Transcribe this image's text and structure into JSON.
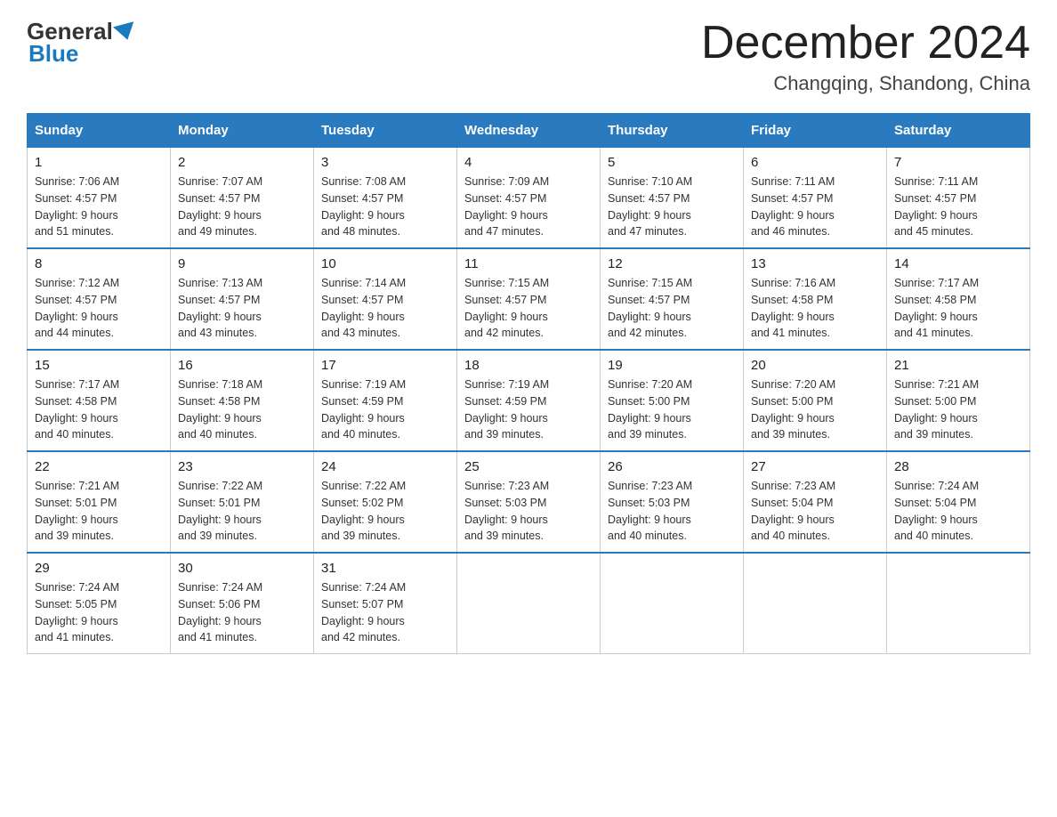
{
  "logo": {
    "general": "General",
    "blue": "Blue",
    "subtitle": "Blue"
  },
  "header": {
    "title": "December 2024",
    "subtitle": "Changqing, Shandong, China"
  },
  "days_of_week": [
    "Sunday",
    "Monday",
    "Tuesday",
    "Wednesday",
    "Thursday",
    "Friday",
    "Saturday"
  ],
  "weeks": [
    [
      {
        "day": "1",
        "sunrise": "7:06 AM",
        "sunset": "4:57 PM",
        "daylight": "9 hours and 51 minutes."
      },
      {
        "day": "2",
        "sunrise": "7:07 AM",
        "sunset": "4:57 PM",
        "daylight": "9 hours and 49 minutes."
      },
      {
        "day": "3",
        "sunrise": "7:08 AM",
        "sunset": "4:57 PM",
        "daylight": "9 hours and 48 minutes."
      },
      {
        "day": "4",
        "sunrise": "7:09 AM",
        "sunset": "4:57 PM",
        "daylight": "9 hours and 47 minutes."
      },
      {
        "day": "5",
        "sunrise": "7:10 AM",
        "sunset": "4:57 PM",
        "daylight": "9 hours and 47 minutes."
      },
      {
        "day": "6",
        "sunrise": "7:11 AM",
        "sunset": "4:57 PM",
        "daylight": "9 hours and 46 minutes."
      },
      {
        "day": "7",
        "sunrise": "7:11 AM",
        "sunset": "4:57 PM",
        "daylight": "9 hours and 45 minutes."
      }
    ],
    [
      {
        "day": "8",
        "sunrise": "7:12 AM",
        "sunset": "4:57 PM",
        "daylight": "9 hours and 44 minutes."
      },
      {
        "day": "9",
        "sunrise": "7:13 AM",
        "sunset": "4:57 PM",
        "daylight": "9 hours and 43 minutes."
      },
      {
        "day": "10",
        "sunrise": "7:14 AM",
        "sunset": "4:57 PM",
        "daylight": "9 hours and 43 minutes."
      },
      {
        "day": "11",
        "sunrise": "7:15 AM",
        "sunset": "4:57 PM",
        "daylight": "9 hours and 42 minutes."
      },
      {
        "day": "12",
        "sunrise": "7:15 AM",
        "sunset": "4:57 PM",
        "daylight": "9 hours and 42 minutes."
      },
      {
        "day": "13",
        "sunrise": "7:16 AM",
        "sunset": "4:58 PM",
        "daylight": "9 hours and 41 minutes."
      },
      {
        "day": "14",
        "sunrise": "7:17 AM",
        "sunset": "4:58 PM",
        "daylight": "9 hours and 41 minutes."
      }
    ],
    [
      {
        "day": "15",
        "sunrise": "7:17 AM",
        "sunset": "4:58 PM",
        "daylight": "9 hours and 40 minutes."
      },
      {
        "day": "16",
        "sunrise": "7:18 AM",
        "sunset": "4:58 PM",
        "daylight": "9 hours and 40 minutes."
      },
      {
        "day": "17",
        "sunrise": "7:19 AM",
        "sunset": "4:59 PM",
        "daylight": "9 hours and 40 minutes."
      },
      {
        "day": "18",
        "sunrise": "7:19 AM",
        "sunset": "4:59 PM",
        "daylight": "9 hours and 39 minutes."
      },
      {
        "day": "19",
        "sunrise": "7:20 AM",
        "sunset": "5:00 PM",
        "daylight": "9 hours and 39 minutes."
      },
      {
        "day": "20",
        "sunrise": "7:20 AM",
        "sunset": "5:00 PM",
        "daylight": "9 hours and 39 minutes."
      },
      {
        "day": "21",
        "sunrise": "7:21 AM",
        "sunset": "5:00 PM",
        "daylight": "9 hours and 39 minutes."
      }
    ],
    [
      {
        "day": "22",
        "sunrise": "7:21 AM",
        "sunset": "5:01 PM",
        "daylight": "9 hours and 39 minutes."
      },
      {
        "day": "23",
        "sunrise": "7:22 AM",
        "sunset": "5:01 PM",
        "daylight": "9 hours and 39 minutes."
      },
      {
        "day": "24",
        "sunrise": "7:22 AM",
        "sunset": "5:02 PM",
        "daylight": "9 hours and 39 minutes."
      },
      {
        "day": "25",
        "sunrise": "7:23 AM",
        "sunset": "5:03 PM",
        "daylight": "9 hours and 39 minutes."
      },
      {
        "day": "26",
        "sunrise": "7:23 AM",
        "sunset": "5:03 PM",
        "daylight": "9 hours and 40 minutes."
      },
      {
        "day": "27",
        "sunrise": "7:23 AM",
        "sunset": "5:04 PM",
        "daylight": "9 hours and 40 minutes."
      },
      {
        "day": "28",
        "sunrise": "7:24 AM",
        "sunset": "5:04 PM",
        "daylight": "9 hours and 40 minutes."
      }
    ],
    [
      {
        "day": "29",
        "sunrise": "7:24 AM",
        "sunset": "5:05 PM",
        "daylight": "9 hours and 41 minutes."
      },
      {
        "day": "30",
        "sunrise": "7:24 AM",
        "sunset": "5:06 PM",
        "daylight": "9 hours and 41 minutes."
      },
      {
        "day": "31",
        "sunrise": "7:24 AM",
        "sunset": "5:07 PM",
        "daylight": "9 hours and 42 minutes."
      },
      null,
      null,
      null,
      null
    ]
  ],
  "labels": {
    "sunrise": "Sunrise:",
    "sunset": "Sunset:",
    "daylight": "Daylight:"
  }
}
